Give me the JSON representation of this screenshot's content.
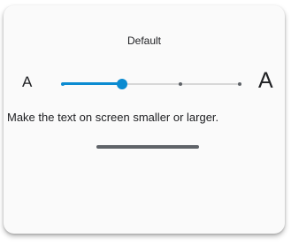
{
  "preview": {
    "level_label": "Default",
    "small_label": "A",
    "large_label": "A",
    "description": "Make the text on screen smaller or larger."
  },
  "slider": {
    "steps": 4,
    "current_index": 1,
    "active_color": "#0b8bd1",
    "inactive_tick_color": "#5f6368"
  }
}
